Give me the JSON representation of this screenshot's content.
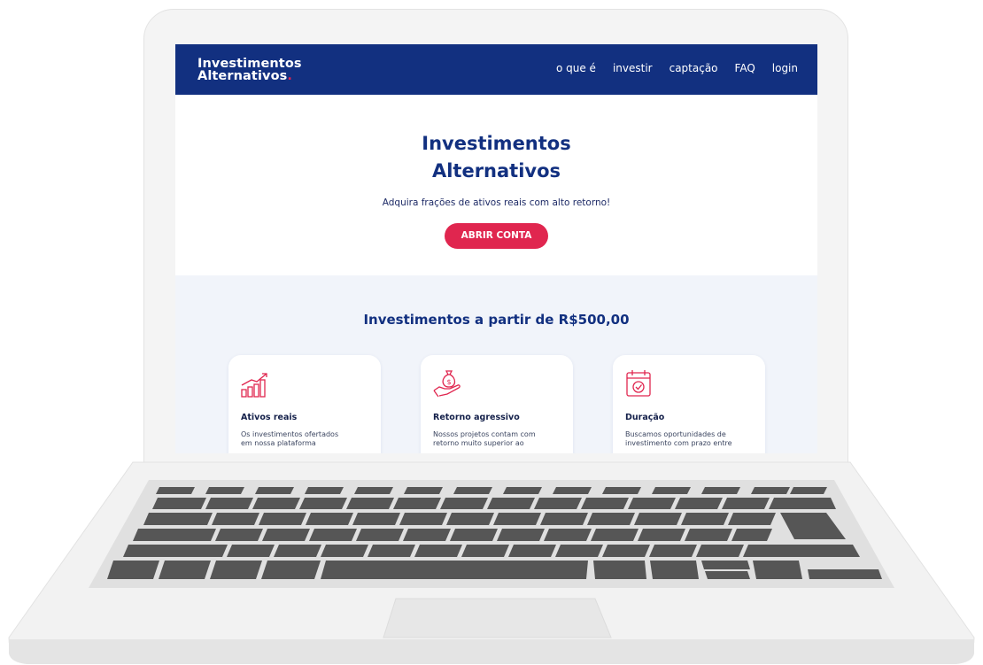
{
  "brand": {
    "line1": "Investimentos",
    "line2": "Alternativos",
    "dot": "."
  },
  "nav": {
    "items": [
      "o que é",
      "investir",
      "captação",
      "FAQ",
      "login"
    ]
  },
  "hero": {
    "title_line1": "Investimentos",
    "title_line2": "Alternativos",
    "subtitle": "Adquira frações de ativos reais com alto retorno!",
    "cta": "ABRIR CONTA"
  },
  "section": {
    "title": "Investimentos a partir de R$500,00",
    "cards": [
      {
        "icon": "growth-chart-icon",
        "title": "Ativos reais",
        "text_line1": "Os investimentos ofertados",
        "text_line2": "em nossa plataforma"
      },
      {
        "icon": "money-bag-hand-icon",
        "title": "Retorno agressivo",
        "text_line1": "Nossos projetos contam com",
        "text_line2": "retorno muito superior ao"
      },
      {
        "icon": "calendar-check-icon",
        "title": "Duração",
        "text_line1": "Buscamos oportunidades de",
        "text_line2": "investimento com prazo entre"
      }
    ]
  },
  "colors": {
    "navy": "#123080",
    "accent": "#e0264f",
    "section_bg": "#f1f4fa"
  }
}
